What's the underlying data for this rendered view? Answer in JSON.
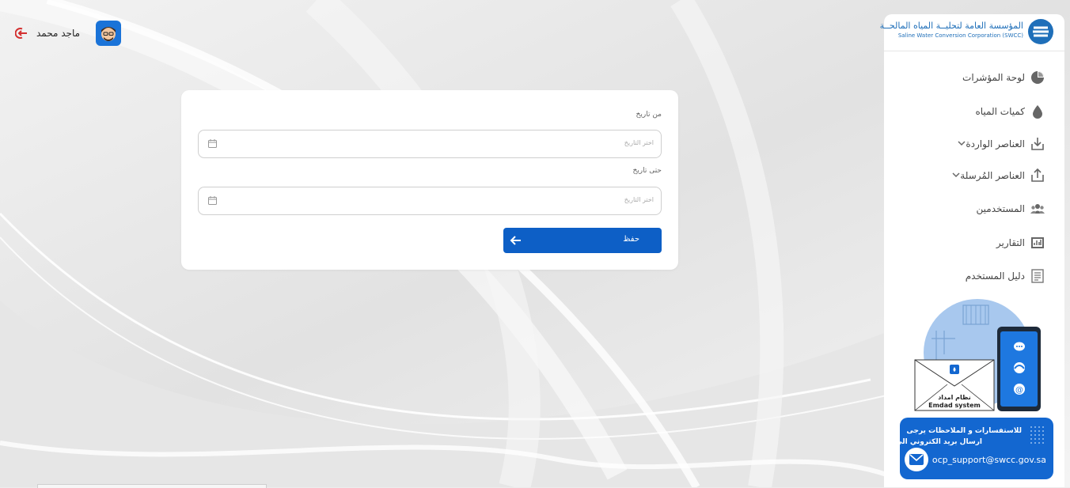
{
  "header": {
    "user_name": "ماجد محمد",
    "avatar_icon": "avatar-face-icon",
    "logout_icon": "logout-icon"
  },
  "form": {
    "from_label": "من تاريخ",
    "from_placeholder": "اختر التاريخ",
    "to_label": "حتى تاريخ",
    "to_placeholder": "اختر التاريخ",
    "submit_label": "حفظ",
    "calendar_icon": "calendar-icon",
    "submit_icon": "arrow-left-icon"
  },
  "sidebar": {
    "logo_ar": "المؤسسة العامة لتحليــة المياه المالحــة",
    "logo_en": "Saline Water Conversion Corporation (SWCC)",
    "items": [
      {
        "label": "لوحة المؤشرات",
        "icon": "pie-chart-icon",
        "dropdown": false
      },
      {
        "label": "كميات المياه",
        "icon": "water-drop-icon",
        "dropdown": false
      },
      {
        "label": "العناصر الواردة",
        "icon": "inbox-download-icon",
        "dropdown": true
      },
      {
        "label": "العناصر المُرسلة",
        "icon": "share-upload-icon",
        "dropdown": true
      },
      {
        "label": "المستخدمين",
        "icon": "users-icon",
        "dropdown": false
      },
      {
        "label": "التقارير",
        "icon": "report-icon",
        "dropdown": false
      },
      {
        "label": "دليل المستخدم",
        "icon": "manual-book-icon",
        "dropdown": false
      }
    ],
    "illustration": {
      "system_name_ar": "نظام امداد",
      "system_name_en": "Emdad system"
    },
    "support": {
      "line1": "للاستفسارات و الملاحظات يرجى",
      "line2": "ارسال بريد الكتروني الى",
      "email": "ocp_support@swcc.gov.sa",
      "mail_icon": "envelope-icon"
    }
  },
  "colors": {
    "primary": "#0d5fc6",
    "support_bg": "#1367d0",
    "logo_blue": "#1f6fb9",
    "logout_red": "#d32f2f"
  }
}
